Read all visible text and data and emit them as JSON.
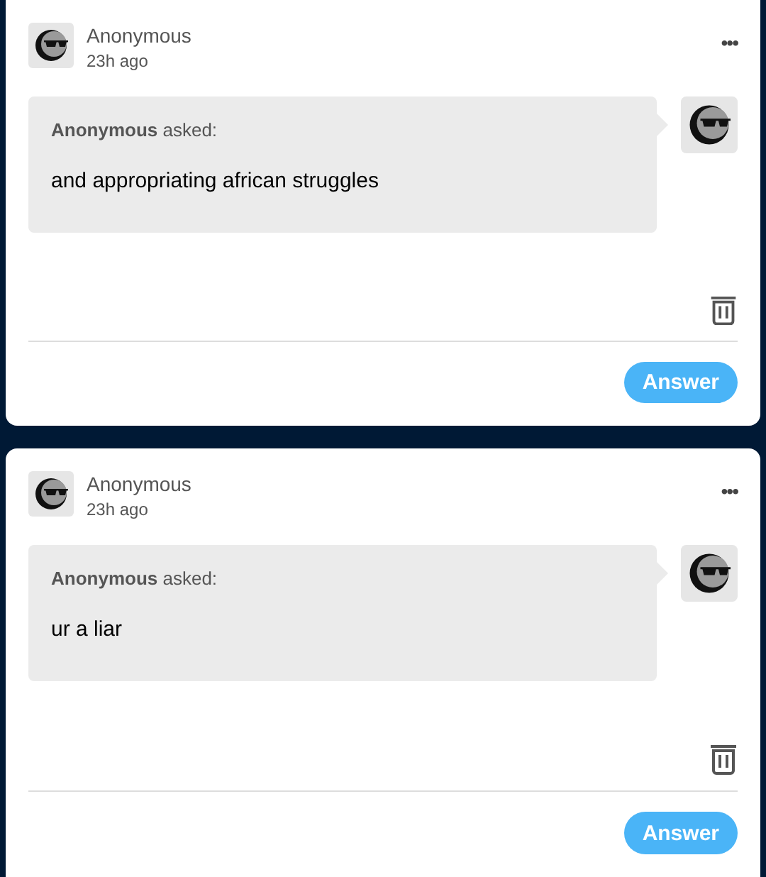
{
  "asks": [
    {
      "name": "Anonymous",
      "time": "23h ago",
      "menu": "•••",
      "header": "**Anonymous** asked:",
      "question": "and appropriating african struggles",
      "button": "Answer"
    },
    {
      "name": "Anonymous",
      "time": "23h ago",
      "menu": "•••",
      "header": "**Anonymous** asked:",
      "question": "ur a liar",
      "button": "Answer"
    }
  ]
}
